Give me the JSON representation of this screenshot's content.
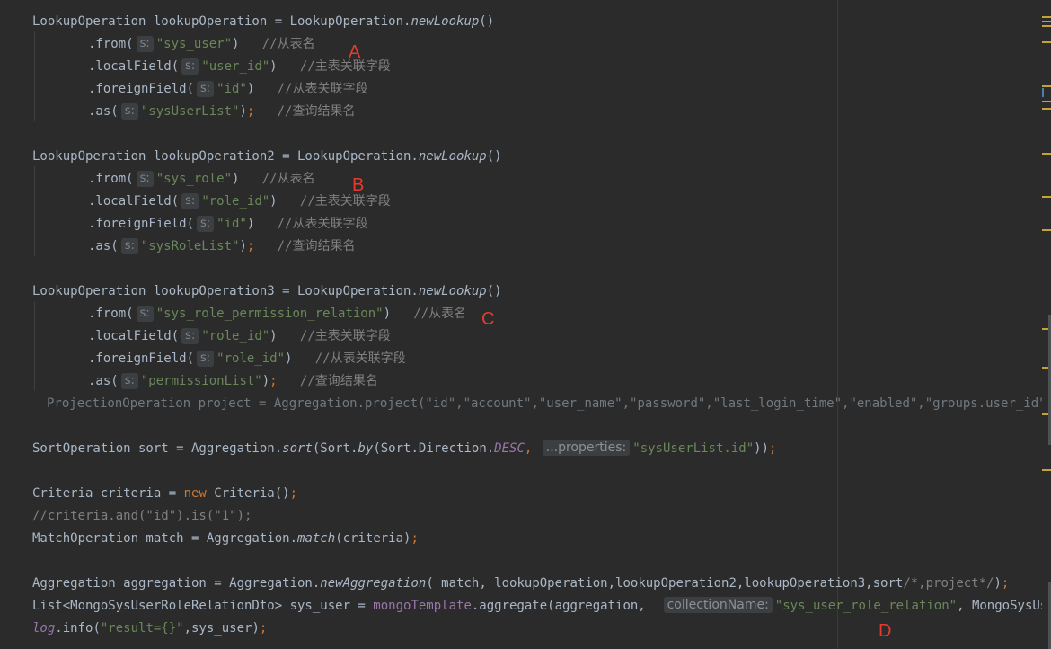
{
  "code": {
    "l1": {
      "a": "LookupOperation lookupOperation = LookupOperation.",
      "fn": "newLookup",
      "b": "()"
    },
    "l2": {
      "a": ".from(",
      "hint": "s:",
      "s": "\"sys_user\"",
      "b": ")   ",
      "c": "//从表名"
    },
    "l3": {
      "a": ".localField(",
      "hint": "s:",
      "s": "\"user_id\"",
      "b": ")   ",
      "c": "//主表关联字段"
    },
    "l4": {
      "a": ".foreignField(",
      "hint": "s:",
      "s": "\"id\"",
      "b": ")   ",
      "c": "//从表关联字段"
    },
    "l5": {
      "a": ".as(",
      "hint": "s:",
      "s": "\"sysUserList\"",
      "b": ")",
      "semi": ";",
      "c": "   //查询结果名"
    },
    "l6": {
      "a": "LookupOperation lookupOperation2 = LookupOperation.",
      "fn": "newLookup",
      "b": "()"
    },
    "l7": {
      "a": ".from(",
      "hint": "s:",
      "s": "\"sys_role\"",
      "b": ")   ",
      "c": "//从表名"
    },
    "l8": {
      "a": ".localField(",
      "hint": "s:",
      "s": "\"role_id\"",
      "b": ")   ",
      "c": "//主表关联字段"
    },
    "l9": {
      "a": ".foreignField(",
      "hint": "s:",
      "s": "\"id\"",
      "b": ")   ",
      "c": "//从表关联字段"
    },
    "l10": {
      "a": ".as(",
      "hint": "s:",
      "s": "\"sysRoleList\"",
      "b": ")",
      "semi": ";",
      "c": "   //查询结果名"
    },
    "l11": {
      "a": "LookupOperation lookupOperation3 = LookupOperation.",
      "fn": "newLookup",
      "b": "()"
    },
    "l12": {
      "a": ".from(",
      "hint": "s:",
      "s": "\"sys_role_permission_relation\"",
      "b": ")   ",
      "c": "//从表名"
    },
    "l13": {
      "a": ".localField(",
      "hint": "s:",
      "s": "\"role_id\"",
      "b": ")   ",
      "c": "//主表关联字段"
    },
    "l14": {
      "a": ".foreignField(",
      "hint": "s:",
      "s": "\"role_id\"",
      "b": ")   ",
      "c": "//从表关联字段"
    },
    "l15": {
      "a": ".as(",
      "hint": "s:",
      "s": "\"permissionList\"",
      "b": ")",
      "semi": ";",
      "c": "   //查询结果名"
    },
    "l16": {
      "a": "ProjectionOperation project = Aggregation.project(\"id\",\"account\",\"user_name\",\"password\",\"last_login_time\",\"enabled\",\"groups.user_id\",\"groups"
    },
    "l17": {
      "a": "SortOperation sort = Aggregation.",
      "fn": "sort",
      "b": "(Sort.",
      "fn2": "by",
      "c": "(Sort.Direction.",
      "cst": "DESC",
      "d": ", ",
      "hint": "...properties:",
      "s": "\"sysUserList.id\"",
      "e": "))",
      "semi": ";"
    },
    "l18": {
      "a": "Criteria criteria = ",
      "kw": "new",
      "b": " Criteria()",
      "semi": ";"
    },
    "l19": {
      "c": "//criteria.and(\"id\").is(\"1\");"
    },
    "l20": {
      "a": "MatchOperation match = Aggregation.",
      "fn": "match",
      "b": "(criteria)",
      "semi": ";"
    },
    "l21": {
      "a": "Aggregation aggregation = Aggregation.",
      "fn": "newAggregation",
      "b": "( match, lookupOperation,lookupOperation2,lookupOperation3,sort",
      "c": "/*,project*/",
      "d": ")",
      "semi": ";"
    },
    "l22": {
      "a": "List<MongoSysUserRoleRelationDto> sys_user = ",
      "fld": "mongoTemplate",
      "b": ".aggregate(aggregation,  ",
      "hint": "collectionName:",
      "s": "\"sys_user_role_relation\"",
      "c": ", MongoSysUserRoleR"
    },
    "l23": {
      "fld": "log",
      "b": ".info(",
      "s": "\"result={}\"",
      "c": ",sys_user)",
      "semi": ";"
    }
  },
  "annotations": {
    "a": "A",
    "b": "B",
    "c": "C",
    "d": "D"
  },
  "colors": {
    "string": "#6a8759",
    "comment": "#808080",
    "keyword": "#cc7832",
    "constant": "#9876aa",
    "text": "#a9b7c6",
    "annotation": "#e53b2e",
    "background": "#2b2b2b"
  }
}
